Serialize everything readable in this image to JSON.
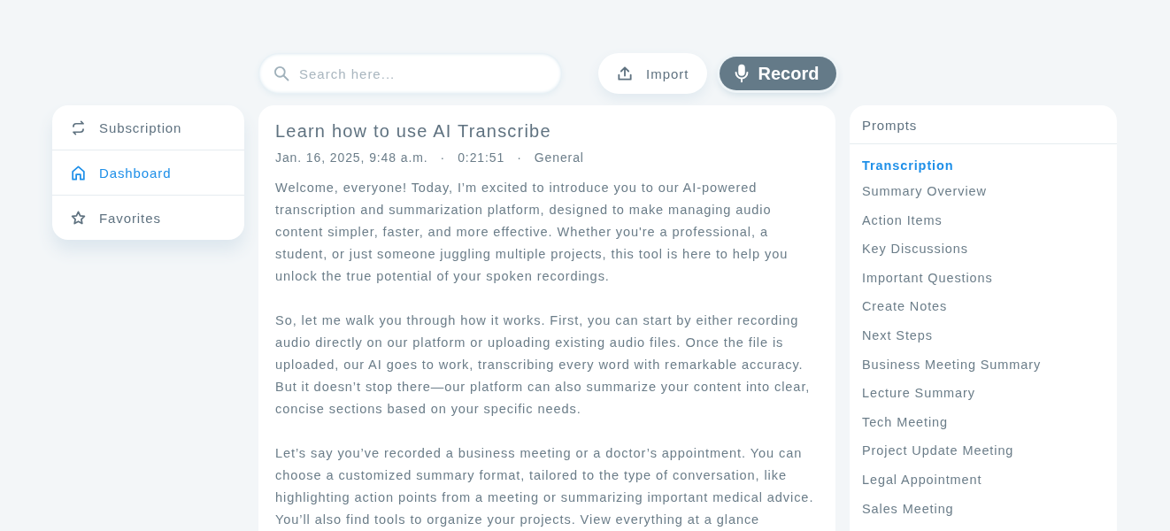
{
  "search": {
    "placeholder": "Search here..."
  },
  "actions": [
    {
      "kind": "import",
      "label": "Import"
    },
    {
      "kind": "record",
      "label": "Record"
    }
  ],
  "sidebar": {
    "items": [
      {
        "kind": "subscription",
        "label": "Subscription",
        "selected": false
      },
      {
        "kind": "dashboard",
        "label": "Dashboard",
        "selected": true
      },
      {
        "kind": "favorites",
        "label": "Favorites",
        "selected": false
      }
    ]
  },
  "document": {
    "title": "Learn how to use AI Transcribe",
    "meta": [
      "Jan. 16, 2025, 9:48 a.m.",
      "0:21:51",
      "General"
    ],
    "separator": "·",
    "paragraphs": [
      "Welcome, everyone! Today, I’m excited to introduce you to our AI-powered transcription and summarization platform, designed to make managing audio content simpler, faster, and more effective. Whether you're a professional, a student, or just someone juggling multiple projects, this tool is here to help you unlock the true potential of your spoken recordings.",
      "So, let me walk you through how it works. First, you can start by either recording audio directly on our platform or uploading existing audio files. Once the file is uploaded, our AI goes to work, transcribing every word with remarkable accuracy. But it doesn’t stop there—our platform can also summarize your content into clear, concise sections based on your specific needs.",
      "Let’s say you’ve recorded a business meeting or a doctor’s appointment. You can choose a customized summary format, tailored to the type of conversation, like highlighting action points from a meeting or summarizing important medical advice. You’ll also find tools to organize your projects. View everything at a glance"
    ]
  },
  "prompts": {
    "title": "Prompts",
    "items": [
      {
        "label": "Transcription",
        "selected": true
      },
      {
        "label": "Summary Overview",
        "selected": false
      },
      {
        "label": "Action Items",
        "selected": false
      },
      {
        "label": "Key Discussions",
        "selected": false
      },
      {
        "label": "Important Questions",
        "selected": false
      },
      {
        "label": "Create Notes",
        "selected": false
      },
      {
        "label": "Next Steps",
        "selected": false
      },
      {
        "label": "Business Meeting Summary",
        "selected": false
      },
      {
        "label": "Lecture Summary",
        "selected": false
      },
      {
        "label": "Tech Meeting",
        "selected": false
      },
      {
        "label": "Project Update Meeting",
        "selected": false
      },
      {
        "label": "Legal Appointment",
        "selected": false
      },
      {
        "label": "Sales Meeting",
        "selected": false
      }
    ]
  }
}
